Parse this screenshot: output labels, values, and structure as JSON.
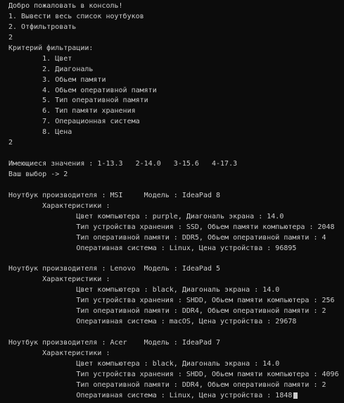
{
  "console": {
    "lines": [
      "Добро пожаловать в консоль!",
      "1. Вывести весь список ноутбуков",
      "2. Отфильтровать",
      "2",
      "Критерий фильтрации:",
      "        1. Цвет",
      "        2. Диагональ",
      "        3. Обьем памяти",
      "        4. Обьем оперативной памяти",
      "        5. Тип оперативной памяти",
      "        6. Тип памяти хранения",
      "        7. Операционная система",
      "        8. Цена",
      "2",
      "",
      "Имеющиеся значения : 1-13.3   2-14.0   3-15.6   4-17.3",
      "Ваш выбор -> 2",
      "",
      "Ноутбук производителя : MSI     Модель : IdeaPad 8",
      "        Характеристики :",
      "                Цвет компьютера : purple, Диагональ экрана : 14.0",
      "                Тип устройства хранения : SSD, Обьем памяти компьютера : 2048",
      "                Тип оперативной памяти : DDR5, Обьем оперативной памяти : 4",
      "                Оперативная система : Linux, Цена устройства : 96895",
      "",
      "Ноутбук производителя : Lenovo  Модель : IdeaPad 5",
      "        Характеристики :",
      "                Цвет компьютера : black, Диагональ экрана : 14.0",
      "                Тип устройства хранения : SHDD, Обьем памяти компьютера : 256",
      "                Тип оперативной памяти : DDR4, Обьем оперативной памяти : 2",
      "                Оперативная система : macOS, Цена устройства : 29678",
      "",
      "Ноутбук производителя : Acer    Модель : IdeaPad 7",
      "        Характеристики :",
      "                Цвет компьютера : black, Диагональ экрана : 14.0",
      "                Тип устройства хранения : SHDD, Обьем памяти компьютера : 4096",
      "                Тип оперативной памяти : DDR4, Обьем оперативной памяти : 2",
      "                Оперативная система : Linux, Цена устройства : 1848"
    ]
  },
  "colors": {
    "background": "#0c0c0c",
    "text": "#cccccc"
  }
}
